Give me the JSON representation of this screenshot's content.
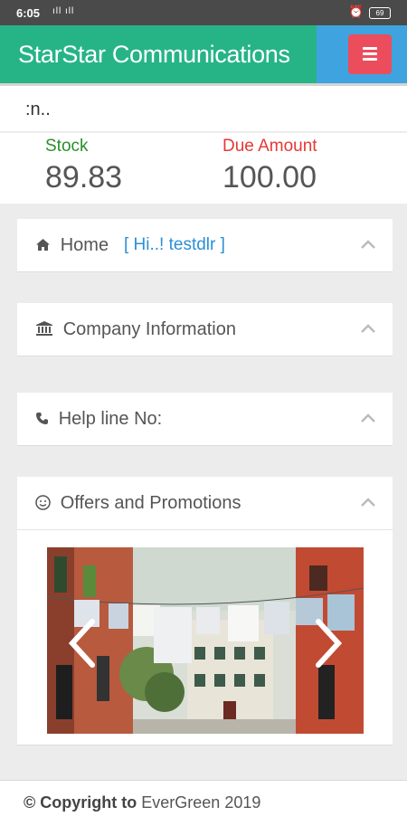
{
  "status_bar": {
    "time": "6:05",
    "signal": "ıll ıll",
    "battery": "69"
  },
  "header": {
    "title": "StarStar Communications",
    "menu_icon": "hamburger-icon"
  },
  "marquee": {
    "text": ":n.."
  },
  "stats": {
    "stock_label": "Stock",
    "stock_value": "89.83",
    "due_label": "Due Amount",
    "due_value": "100.00"
  },
  "panels": {
    "home": {
      "icon": "home-icon",
      "title": "Home",
      "greeting": "[ Hi..!  testdlr ]"
    },
    "company": {
      "icon": "bank-icon",
      "title": "Company Information"
    },
    "helpline": {
      "icon": "phone-icon",
      "title": "Help line No:"
    },
    "offers": {
      "icon": "smile-icon",
      "title": "Offers and Promotions"
    }
  },
  "footer": {
    "copyright_symbol": "©",
    "copyright_label": "Copyright to",
    "owner": "EverGreen 2019"
  },
  "colors": {
    "brand_green": "#26b486",
    "header_blue": "#3fa3e0",
    "menu_red": "#ec4d5d",
    "stock_green": "#2a8f2a",
    "due_red": "#e53935",
    "link_blue": "#2a8fd7"
  }
}
